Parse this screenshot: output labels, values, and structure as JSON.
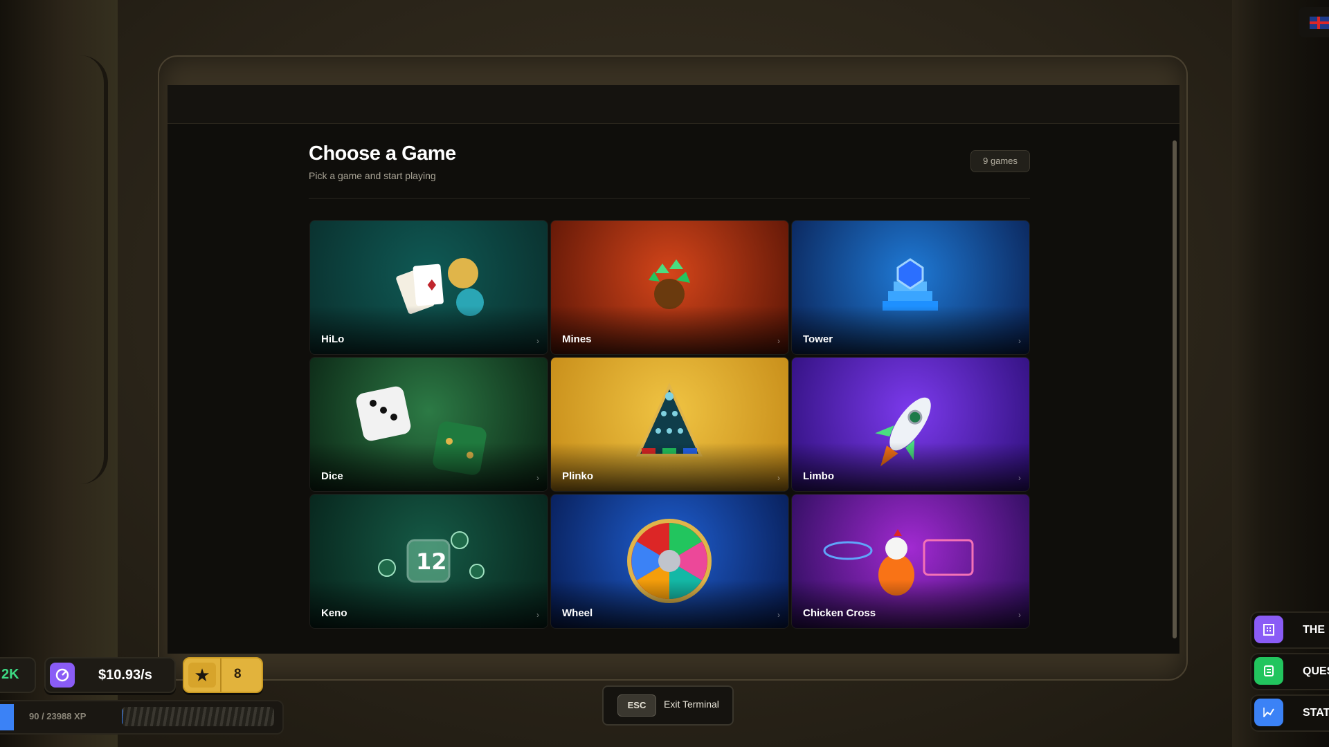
{
  "header": {
    "title": "Choose a Game",
    "subtitle": "Pick a game and start playing",
    "count": "9 games"
  },
  "games": [
    {
      "label": "HiLo",
      "icon": "playing-cards",
      "colors": [
        "#0f5a55",
        "#0a2e2c"
      ]
    },
    {
      "label": "Mines",
      "icon": "gem-bomb",
      "colors": [
        "#d4451a",
        "#5a1506"
      ]
    },
    {
      "label": "Tower",
      "icon": "blue-tower",
      "colors": [
        "#1f7ad6",
        "#0a2154"
      ]
    },
    {
      "label": "Dice",
      "icon": "dice",
      "colors": [
        "#2c7a45",
        "#0b2414"
      ]
    },
    {
      "label": "Plinko",
      "icon": "plinko-board",
      "colors": [
        "#f0c443",
        "#c58a17"
      ]
    },
    {
      "label": "Limbo",
      "icon": "rocket",
      "colors": [
        "#7c3aed",
        "#2e0f7a"
      ]
    },
    {
      "label": "Keno",
      "icon": "number-balls",
      "colors": [
        "#155a46",
        "#07221a"
      ]
    },
    {
      "label": "Wheel",
      "icon": "color-wheel",
      "colors": [
        "#1f5fd1",
        "#071b52"
      ]
    },
    {
      "label": "Chicken Cross",
      "icon": "chicken-neon",
      "colors": [
        "#a12ad1",
        "#2a0d5a"
      ]
    }
  ],
  "hud": {
    "left_value": "2K",
    "income": "$10.93/s",
    "stars": "8",
    "xp_text": "90 / 23988 XP",
    "xp_progress": 0.004
  },
  "terminal": {
    "esc_key": "ESC",
    "exit_label": "Exit Terminal"
  },
  "side_menu": [
    {
      "label": "THE",
      "icon": "building-icon",
      "color": "#8a5cf6"
    },
    {
      "label": "QUES",
      "icon": "quest-icon",
      "color": "#22c55e"
    },
    {
      "label": "STAT",
      "icon": "chart-icon",
      "color": "#3b82f6"
    }
  ]
}
